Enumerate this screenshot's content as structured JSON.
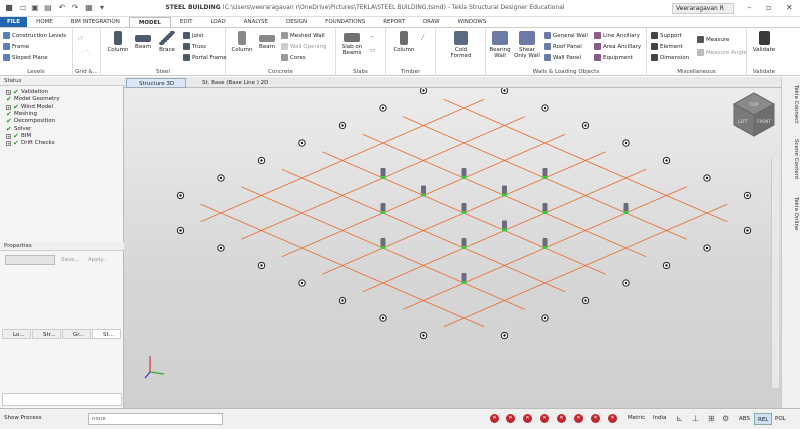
{
  "window": {
    "title_main": "STEEL BUILDING",
    "title_path": " (C:\\Users\\veeraragavan r\\OneDrive\\Pictures\\TEKLA\\STEEL BUILDING.tsmd)",
    "title_app": " - Tekla Structural Designer Educational",
    "user": "Veeraragavan R"
  },
  "menu": [
    "FILE",
    "HOME",
    "BIM INTEGRATION",
    "MODEL",
    "EDIT",
    "LOAD",
    "ANALYSE",
    "DESIGN",
    "FOUNDATIONS",
    "REPORT",
    "DRAW",
    "WINDOWS"
  ],
  "active_menu": "MODEL",
  "ribbon": {
    "levels": {
      "label": "Levels",
      "items": [
        "Construction Levels",
        "Frame",
        "Sloped Plane"
      ]
    },
    "grid": {
      "label": "Grid &..."
    },
    "steel": {
      "label": "Steel",
      "column": "Column",
      "beam": "Beam",
      "brace": "Brace",
      "joist": "Joist",
      "truss": "Truss",
      "portal": "Portal Frame"
    },
    "concrete": {
      "label": "Concrete",
      "column": "Column",
      "beam": "Beam",
      "meshed_wall": "Meshed Wall",
      "wall_opening": "Wall Opening",
      "cores": "Cores"
    },
    "slabs": {
      "label": "Slabs",
      "slab": "Slab on Beams"
    },
    "timber": {
      "label": "Timber",
      "column": "Column"
    },
    "cold": {
      "label": "",
      "cold": "Cold Formed"
    },
    "walls": {
      "label": "Walls & Loading Objects",
      "bearing": "Bearing Wall",
      "shear": "Shear Only Wall",
      "general": "General Wall",
      "roof": "Roof Panel",
      "wall_panel": "Wall Panel",
      "line_ancillary": "Line Ancillary",
      "area_ancillary": "Area Ancillary",
      "equipment": "Equipment"
    },
    "misc": {
      "label": "Miscellaneous",
      "support": "Support",
      "element": "Element",
      "dimension": "Dimension",
      "measure": "Measure",
      "measure_angle": "Measure Angle"
    },
    "validate": {
      "label": "Validate",
      "validate": "Validate"
    }
  },
  "doc_tabs": [
    "Structure 3D",
    "St. Base (Base Line ) 2D"
  ],
  "status_panel": {
    "title": "Status",
    "items": [
      {
        "label": "Validation",
        "type": "expander"
      },
      {
        "label": "Model Geometry",
        "type": "check"
      },
      {
        "label": "Wind Model",
        "type": "expander"
      },
      {
        "label": "Meshing",
        "type": "check"
      },
      {
        "label": "Decomposition",
        "type": "check"
      },
      {
        "label": "Solver",
        "type": "check"
      },
      {
        "label": "BIM",
        "type": "expander"
      },
      {
        "label": "Drift Checks",
        "type": "expander"
      }
    ]
  },
  "panel_tabs": [
    "Lo...",
    "Str...",
    "Gr...",
    "St..."
  ],
  "properties": {
    "title": "Properties",
    "save": "Save...",
    "apply": "Apply..."
  },
  "viewcube": {
    "top": "TOP",
    "left": "LEFT",
    "front": "FRONT"
  },
  "right_tabs": [
    "Tekla Connect",
    "Scene Content",
    "Tekla Online"
  ],
  "statusbar": {
    "show_process": "Show Process",
    "none": "none",
    "units": "Metric",
    "region": "India",
    "modes": [
      "ABS",
      "REL",
      "POL"
    ],
    "active_mode": "REL"
  },
  "colors": {
    "accent": "#1f66b0",
    "grid_line": "#e8692a",
    "column_green": "#3cc83c",
    "column_body": "#6b6b7b"
  }
}
